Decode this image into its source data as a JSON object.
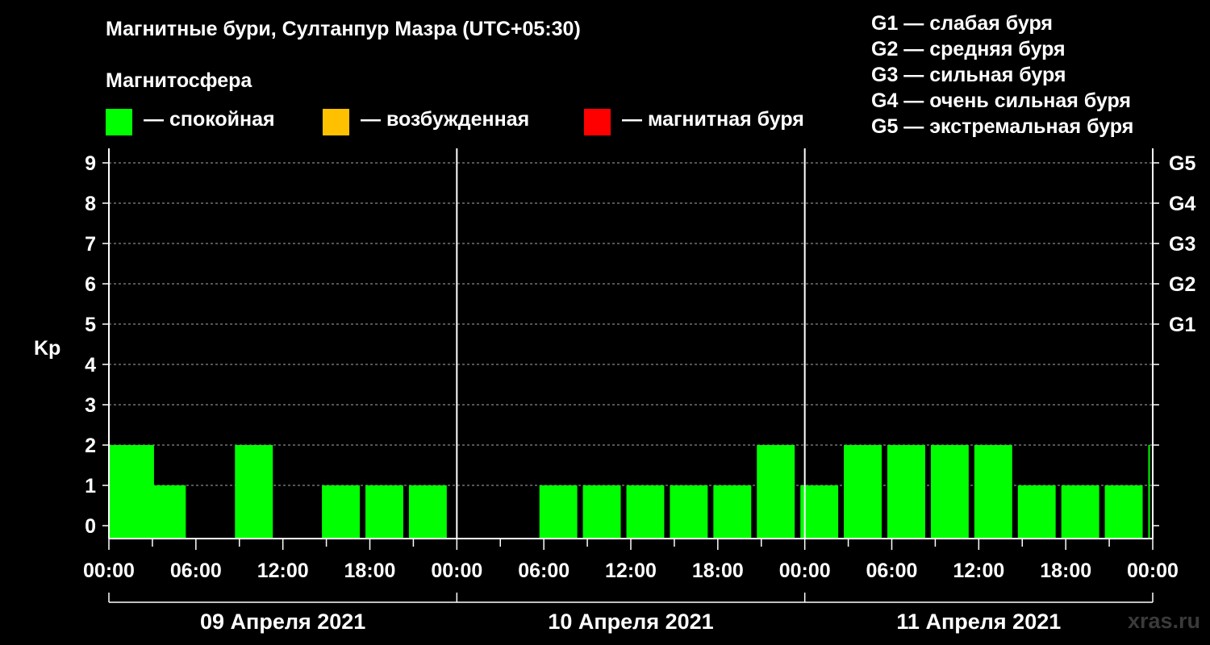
{
  "title": "Магнитные бури, Султанпур Мазра (UTC+05:30)",
  "magnetosphere": {
    "title": "Магнитосфера",
    "items": [
      {
        "label": "— спокойная",
        "color": "#00ff00"
      },
      {
        "label": "— возбужденная",
        "color": "#ffc000"
      },
      {
        "label": "— магнитная буря",
        "color": "#ff0000"
      }
    ]
  },
  "g_scale": [
    "G1 — слабая буря",
    "G2 — средняя буря",
    "G3 — сильная буря",
    "G4 — очень сильная буря",
    "G5 — экстремальная буря"
  ],
  "footer": "xras.ru",
  "chart_data": {
    "type": "bar",
    "ylabel": "Kp",
    "ylim": [
      0,
      9
    ],
    "y_ticks": [
      "0",
      "1",
      "2",
      "3",
      "4",
      "5",
      "6",
      "7",
      "8",
      "9"
    ],
    "right_ticks": [
      {
        "kp": 5,
        "label": "G1"
      },
      {
        "kp": 6,
        "label": "G2"
      },
      {
        "kp": 7,
        "label": "G3"
      },
      {
        "kp": 8,
        "label": "G4"
      },
      {
        "kp": 9,
        "label": "G5"
      }
    ],
    "x_tick_labels": [
      "00:00",
      "06:00",
      "12:00",
      "18:00",
      "00:00",
      "06:00",
      "12:00",
      "18:00",
      "00:00",
      "06:00",
      "12:00",
      "18:00",
      "00:00"
    ],
    "days": [
      "09 Апреля 2021",
      "10 Апреля 2021",
      "11 Апреля 2021"
    ],
    "grid": true,
    "bar_color": "#00ff00",
    "bars": [
      {
        "start": "2021-04-09 00:00",
        "end": "2021-04-09 03:30",
        "kp": 2
      },
      {
        "start": "2021-04-09 02:30",
        "end": "2021-04-09 05:30",
        "kp": 1
      },
      {
        "start": "2021-04-09 05:30",
        "end": "2021-04-09 08:30",
        "kp": 0
      },
      {
        "start": "2021-04-09 08:30",
        "end": "2021-04-09 11:30",
        "kp": 2
      },
      {
        "start": "2021-04-09 11:30",
        "end": "2021-04-09 14:30",
        "kp": 0
      },
      {
        "start": "2021-04-09 14:30",
        "end": "2021-04-09 17:30",
        "kp": 1
      },
      {
        "start": "2021-04-09 17:30",
        "end": "2021-04-09 20:30",
        "kp": 1
      },
      {
        "start": "2021-04-09 20:30",
        "end": "2021-04-09 23:30",
        "kp": 1
      },
      {
        "start": "2021-04-09 23:30",
        "end": "2021-04-10 02:30",
        "kp": 0
      },
      {
        "start": "2021-04-10 02:30",
        "end": "2021-04-10 05:30",
        "kp": 0
      },
      {
        "start": "2021-04-10 05:30",
        "end": "2021-04-10 08:30",
        "kp": 1
      },
      {
        "start": "2021-04-10 08:30",
        "end": "2021-04-10 11:30",
        "kp": 1
      },
      {
        "start": "2021-04-10 11:30",
        "end": "2021-04-10 14:30",
        "kp": 1
      },
      {
        "start": "2021-04-10 14:30",
        "end": "2021-04-10 17:30",
        "kp": 1
      },
      {
        "start": "2021-04-10 17:30",
        "end": "2021-04-10 20:30",
        "kp": 1
      },
      {
        "start": "2021-04-10 20:30",
        "end": "2021-04-10 23:30",
        "kp": 2
      },
      {
        "start": "2021-04-10 23:30",
        "end": "2021-04-11 02:30",
        "kp": 1
      },
      {
        "start": "2021-04-11 02:30",
        "end": "2021-04-11 05:30",
        "kp": 2
      },
      {
        "start": "2021-04-11 05:30",
        "end": "2021-04-11 08:30",
        "kp": 2
      },
      {
        "start": "2021-04-11 08:30",
        "end": "2021-04-11 11:30",
        "kp": 2
      },
      {
        "start": "2021-04-11 11:30",
        "end": "2021-04-11 14:30",
        "kp": 2
      },
      {
        "start": "2021-04-11 14:30",
        "end": "2021-04-11 17:30",
        "kp": 1
      },
      {
        "start": "2021-04-11 17:30",
        "end": "2021-04-11 20:30",
        "kp": 1
      },
      {
        "start": "2021-04-11 20:30",
        "end": "2021-04-11 23:30",
        "kp": 1
      },
      {
        "start": "2021-04-11 23:30",
        "end": "2021-04-12 00:00",
        "kp": 2
      }
    ]
  }
}
